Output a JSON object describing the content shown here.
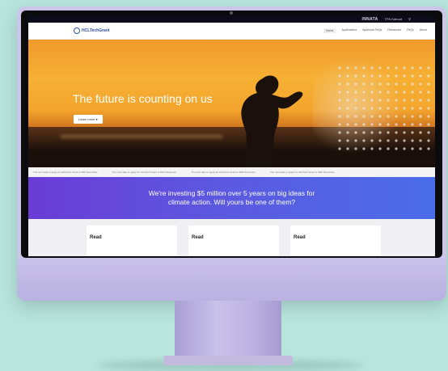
{
  "utility_bar": {
    "brand": "INNATA",
    "link1": "TFN Kahoot",
    "icon": "search-icon"
  },
  "nav": {
    "logo": "HCLTechGrant",
    "links": [
      "Home",
      "Applications",
      "Applicant FAQs",
      "Resources",
      "FAQs",
      "About"
    ]
  },
  "hero": {
    "title": "The future is counting on us",
    "button": "Learn more ▾"
  },
  "ticker": [
    "The next date to apply for HCLTech Grant is 30th November",
    "The next date to apply for HCLTech Grant is 30th November",
    "The next date to apply for HCLTech Grant is 30th November",
    "The next date to apply for HCLTech Grant is 30th November"
  ],
  "banner": {
    "line1": "We're investing $5 million over 5 years on big ideas for",
    "line2": "climate action. Will yours be one of them?"
  },
  "cards": [
    "Read",
    "Read",
    "Read"
  ],
  "colors": {
    "banner_start": "#6a3cd6",
    "banner_end": "#4a6de8",
    "hero_orange": "#f3a52d",
    "device": "#cbc6e8",
    "background": "#b8e6dc"
  }
}
